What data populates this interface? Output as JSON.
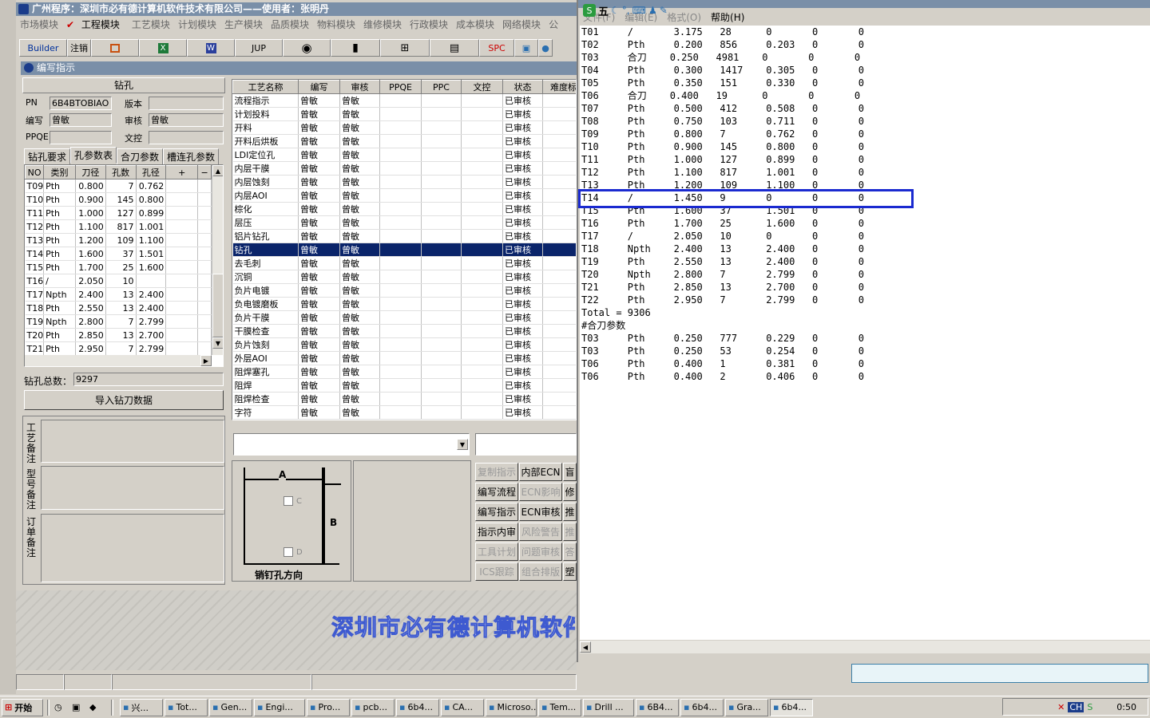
{
  "app": {
    "title": "广州程序：深圳市必有德计算机软件技术有限公司——使用者：张明丹",
    "menu": [
      "市场模块",
      "工程模块",
      "工艺模块",
      "计划模块",
      "生产模块",
      "品质模块",
      "物料模块",
      "维修模块",
      "行政模块",
      "成本模块",
      "网络模块",
      "公"
    ],
    "toolbar": [
      "Builder",
      "注销",
      "calendar-icon",
      "excel-icon",
      "word-icon",
      "JUP",
      "eye-icon",
      "phone-icon",
      "network-icon",
      "printer-icon",
      "SPC",
      "save-icon",
      "link-icon"
    ],
    "subwindow_title": "编写指示"
  },
  "left": {
    "section_title": "钻孔",
    "pn_label": "PN",
    "pn_value": "6B4BTOBIAO",
    "version_label": "版本",
    "version_value": "",
    "writer_label": "编写",
    "writer_value": "曾敏",
    "reviewer_label": "审核",
    "reviewer_value": "曾敏",
    "ppqe_label": "PPQE",
    "ppqe_value": "",
    "doc_label": "文控",
    "doc_value": "",
    "tabs": [
      "钻孔要求",
      "孔参数表",
      "合刀参数",
      "槽连孔参数"
    ],
    "grid_headers": [
      "NO",
      "类别",
      "刀径",
      "孔数",
      "孔径",
      "+",
      "−"
    ],
    "grid_rows": [
      [
        "T09",
        "Pth",
        "0.800",
        "7",
        "0.762"
      ],
      [
        "T10",
        "Pth",
        "0.900",
        "145",
        "0.800"
      ],
      [
        "T11",
        "Pth",
        "1.000",
        "127",
        "0.899"
      ],
      [
        "T12",
        "Pth",
        "1.100",
        "817",
        "1.001"
      ],
      [
        "T13",
        "Pth",
        "1.200",
        "109",
        "1.100"
      ],
      [
        "T14",
        "Pth",
        "1.600",
        "37",
        "1.501"
      ],
      [
        "T15",
        "Pth",
        "1.700",
        "25",
        "1.600"
      ],
      [
        "T16",
        "/",
        "2.050",
        "10",
        ""
      ],
      [
        "T17",
        "Npth",
        "2.400",
        "13",
        "2.400"
      ],
      [
        "T18",
        "Pth",
        "2.550",
        "13",
        "2.400"
      ],
      [
        "T19",
        "Npth",
        "2.800",
        "7",
        "2.799"
      ],
      [
        "T20",
        "Pth",
        "2.850",
        "13",
        "2.700"
      ],
      [
        "T21",
        "Pth",
        "2.950",
        "7",
        "2.799"
      ]
    ],
    "total_label": "钻孔总数：",
    "total_value": "9297",
    "import_button": "导入钻刀数据",
    "note_labels": [
      "工艺备注",
      "型号备注",
      "订单备注"
    ]
  },
  "process": {
    "headers": [
      "工艺名称",
      "编写",
      "审核",
      "PPQE",
      "PPC",
      "文控",
      "状态",
      "难度标"
    ],
    "rows": [
      [
        "流程指示",
        "曾敏",
        "曾敏",
        "",
        "",
        "",
        "已审核"
      ],
      [
        "计划投料",
        "曾敏",
        "曾敏",
        "",
        "",
        "",
        "已审核"
      ],
      [
        "开料",
        "曾敏",
        "曾敏",
        "",
        "",
        "",
        "已审核"
      ],
      [
        "开料后烘板",
        "曾敏",
        "曾敏",
        "",
        "",
        "",
        "已审核"
      ],
      [
        "LDI定位孔",
        "曾敏",
        "曾敏",
        "",
        "",
        "",
        "已审核"
      ],
      [
        "内层干膜",
        "曾敏",
        "曾敏",
        "",
        "",
        "",
        "已审核"
      ],
      [
        "内层蚀刻",
        "曾敏",
        "曾敏",
        "",
        "",
        "",
        "已审核"
      ],
      [
        "内层AOI",
        "曾敏",
        "曾敏",
        "",
        "",
        "",
        "已审核"
      ],
      [
        "棕化",
        "曾敏",
        "曾敏",
        "",
        "",
        "",
        "已审核"
      ],
      [
        "层压",
        "曾敏",
        "曾敏",
        "",
        "",
        "",
        "已审核"
      ],
      [
        "铝片钻孔",
        "曾敏",
        "曾敏",
        "",
        "",
        "",
        "已审核"
      ],
      [
        "钻孔",
        "曾敏",
        "曾敏",
        "",
        "",
        "",
        "已审核"
      ],
      [
        "去毛刺",
        "曾敏",
        "曾敏",
        "",
        "",
        "",
        "已审核"
      ],
      [
        "沉铜",
        "曾敏",
        "曾敏",
        "",
        "",
        "",
        "已审核"
      ],
      [
        "负片电镀",
        "曾敏",
        "曾敏",
        "",
        "",
        "",
        "已审核"
      ],
      [
        "负电镀磨板",
        "曾敏",
        "曾敏",
        "",
        "",
        "",
        "已审核"
      ],
      [
        "负片干膜",
        "曾敏",
        "曾敏",
        "",
        "",
        "",
        "已审核"
      ],
      [
        "干膜检查",
        "曾敏",
        "曾敏",
        "",
        "",
        "",
        "已审核"
      ],
      [
        "负片蚀刻",
        "曾敏",
        "曾敏",
        "",
        "",
        "",
        "已审核"
      ],
      [
        "外层AOI",
        "曾敏",
        "曾敏",
        "",
        "",
        "",
        "已审核"
      ],
      [
        "阻焊塞孔",
        "曾敏",
        "曾敏",
        "",
        "",
        "",
        "已审核"
      ],
      [
        "阻焊",
        "曾敏",
        "曾敏",
        "",
        "",
        "",
        "已审核"
      ],
      [
        "阻焊检查",
        "曾敏",
        "曾敏",
        "",
        "",
        "",
        "已审核"
      ],
      [
        "字符",
        "曾敏",
        "曾敏",
        "",
        "",
        "",
        "已审核"
      ]
    ],
    "selected_index": 11
  },
  "diagram": {
    "a": "A",
    "b": "B",
    "c": "C",
    "d": "D",
    "caption": "销钉孔方向"
  },
  "actions": [
    [
      {
        "label": "复制指示",
        "enabled": false
      },
      {
        "label": "内部ECN",
        "enabled": true
      },
      {
        "label": "盲",
        "enabled": true
      }
    ],
    [
      {
        "label": "编写流程",
        "enabled": true
      },
      {
        "label": "ECN影响",
        "enabled": false
      },
      {
        "label": "修",
        "enabled": true
      }
    ],
    [
      {
        "label": "编写指示",
        "enabled": true
      },
      {
        "label": "ECN审核",
        "enabled": true
      },
      {
        "label": "推",
        "enabled": true
      }
    ],
    [
      {
        "label": "指示内审",
        "enabled": true
      },
      {
        "label": "风险警告",
        "enabled": false
      },
      {
        "label": "推",
        "enabled": false
      }
    ],
    [
      {
        "label": "工具计划",
        "enabled": false
      },
      {
        "label": "问题审核",
        "enabled": false
      },
      {
        "label": "答",
        "enabled": false
      }
    ],
    [
      {
        "label": "ICS跟踪",
        "enabled": false
      },
      {
        "label": "组合排版",
        "enabled": false
      },
      {
        "label": "塑",
        "enabled": true
      }
    ]
  ],
  "watermark": "深圳市必有德计算机软件",
  "notepad": {
    "menu": [
      "文件(F)",
      "编辑(E)",
      "格式(O)",
      "帮助(H)"
    ],
    "ime": [
      "五",
      "拼"
    ],
    "lines": [
      "T01     /       3.175   28      0       0       0",
      "T02     Pth     0.200   856     0.203   0       0",
      "T03     合刀    0.250   4981    0       0       0",
      "T04     Pth     0.300   1417    0.305   0       0",
      "T05     Pth     0.350   151     0.330   0       0",
      "T06     合刀    0.400   19      0       0       0",
      "T07     Pth     0.500   412     0.508   0       0",
      "T08     Pth     0.750   103     0.711   0       0",
      "T09     Pth     0.800   7       0.762   0       0",
      "T10     Pth     0.900   145     0.800   0       0",
      "T11     Pth     1.000   127     0.899   0       0",
      "T12     Pth     1.100   817     1.001   0       0",
      "T13     Pth     1.200   109     1.100   0       0",
      "T14     /       1.450   9       0       0       0",
      "T15     Pth     1.600   37      1.501   0       0",
      "T16     Pth     1.700   25      1.600   0       0",
      "T17     /       2.050   10      0       0       0",
      "T18     Npth    2.400   13      2.400   0       0",
      "T19     Pth     2.550   13      2.400   0       0",
      "T20     Npth    2.800   7       2.799   0       0",
      "T21     Pth     2.850   13      2.700   0       0",
      "T22     Pth     2.950   7       2.799   0       0",
      "Total = 9306",
      "#合刀参数",
      "T03     Pth     0.250   777     0.229   0       0",
      "T03     Pth     0.250   53      0.254   0       0",
      "T06     Pth     0.400   1       0.381   0       0",
      "T06     Pth     0.400   2       0.406   0       0"
    ]
  },
  "taskbar": {
    "start": "开始",
    "items": [
      "兴...",
      "Tot...",
      "Gen...",
      "Engi...",
      "Pro...",
      "pcb...",
      "6b4...",
      "CA...",
      "Microso...",
      "Tem...",
      "Drill ...",
      "6B4...",
      "6b4...",
      "Gra...",
      "6b4..."
    ],
    "clock": "0:50",
    "lang": "CH"
  },
  "colors": {
    "selection": "#0a246a",
    "highlight_box": "#1a2ad0",
    "titlebar": "#7a8fa8"
  }
}
